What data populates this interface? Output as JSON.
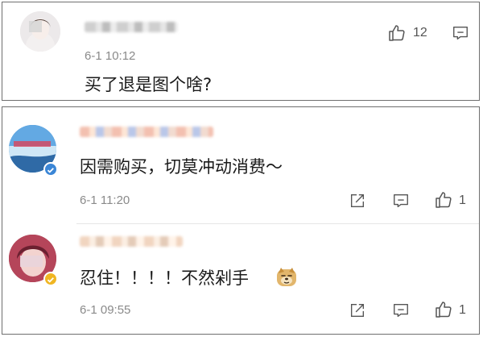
{
  "comments": [
    {
      "timestamp": "6-1 10:12",
      "text": "买了退是图个啥?",
      "likes": "12"
    },
    {
      "timestamp": "6-1 11:20",
      "text": "因需购买，切莫冲动消费～",
      "likes": "1",
      "verified_badge_color": "#3b86d6"
    },
    {
      "timestamp": "6-1 09:55",
      "text": "忍住！！！！不然剁手",
      "likes": "1",
      "verified_badge_color": "#f0b623",
      "emoji": "doge-emoji"
    }
  ],
  "icons": {
    "like": "thumbs-up-icon",
    "reply": "comment-icon",
    "share": "share-icon"
  }
}
